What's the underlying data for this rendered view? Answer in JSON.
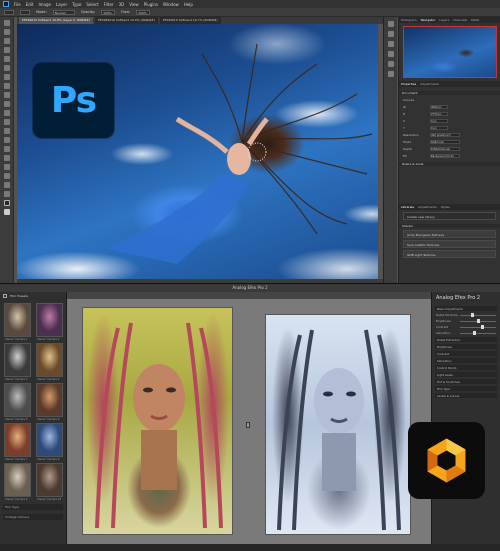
{
  "photoshop": {
    "menu": [
      "File",
      "Edit",
      "Image",
      "Layer",
      "Type",
      "Select",
      "Filter",
      "3D",
      "View",
      "Plugins",
      "Window",
      "Help"
    ],
    "options": {
      "mode_label": "Mode:",
      "mode_value": "Normal",
      "opacity_label": "Opacity:",
      "opacity_value": "100%",
      "flow_label": "Flow:",
      "flow_value": "100%"
    },
    "tabs": [
      "PF099010 SoftLand 16.8% (Layer 0, RGB/8#)",
      "PF0989010 SoftLand 16.9% (RGB/8#)",
      "PF099010 SoftLand 16.7% (RGB/8#)"
    ],
    "logo_text": "Ps",
    "right_panel": {
      "tabs": [
        "Histogram",
        "Navigator",
        "Layers",
        "Channels",
        "Paths"
      ],
      "properties_tabs": [
        "Properties",
        "Adjustments"
      ],
      "doc_label": "Document",
      "rows": [
        {
          "label": "Canvas",
          "value": ""
        },
        {
          "label": "W",
          "value": "4096 px"
        },
        {
          "label": "H",
          "value": "2730 px"
        },
        {
          "label": "X",
          "value": "0 px"
        },
        {
          "label": "Y",
          "value": "0 px"
        },
        {
          "label": "Resolution",
          "value": "300 pixels/inch"
        },
        {
          "label": "Mode",
          "value": "RGB Color"
        },
        {
          "label": "Depth",
          "value": "8 Bits/Channel"
        },
        {
          "label": "Fill",
          "value": "Background Color"
        }
      ],
      "rulers_label": "Rulers & Grids",
      "library_tabs": [
        "Libraries",
        "Adjustments",
        "Styles"
      ],
      "library_button": "Create new library",
      "library_heading": "Shared",
      "library_items": [
        "Andy Bourgeois Textures",
        "Sara Castillo Textures",
        "GDB Light Textures"
      ]
    }
  },
  "analog": {
    "title": "Analog Efex Pro 2",
    "left_head": "Film Presets",
    "thumbs": [
      {
        "caption": "Classic Camera 1",
        "c1": "#d7c2a8",
        "c2": "#5a4a3e"
      },
      {
        "caption": "Classic Camera 2",
        "c1": "#c27aa8",
        "c2": "#4a3050"
      },
      {
        "caption": "Classic Camera 3",
        "c1": "#cfcfcf",
        "c2": "#3a3a3a"
      },
      {
        "caption": "Classic Camera 4",
        "c1": "#e0c28a",
        "c2": "#6b4a2a"
      },
      {
        "caption": "Classic Camera 5",
        "c1": "#bcbcbc",
        "c2": "#4c4c4c"
      },
      {
        "caption": "Classic Camera 6",
        "c1": "#d89a6a",
        "c2": "#5a3a2a"
      },
      {
        "caption": "Classic Camera 7",
        "c1": "#e7b07a",
        "c2": "#7a3e2a"
      },
      {
        "caption": "Classic Camera 8",
        "c1": "#9ab8e0",
        "c2": "#2e4a7a"
      },
      {
        "caption": "Classic Camera 9",
        "c1": "#d6cdbd",
        "c2": "#6a6050"
      },
      {
        "caption": "Classic Camera 10",
        "c1": "#b49a8a",
        "c2": "#4a3a30"
      }
    ],
    "left_bars": [
      "Film Type",
      "Vintage Camera"
    ],
    "right_title": "Analog Efex Pro 2",
    "right_sections": [
      "Basic Adjustments",
      "Detail Extraction",
      "Brightness",
      "Contrast",
      "Saturation",
      "Control Points",
      "Light Leaks",
      "Dirt & Scratches",
      "Film Type",
      "Levels & Curves"
    ],
    "sliders": [
      {
        "label": "Detail Extraction",
        "pct": 0.35
      },
      {
        "label": "Brightness",
        "pct": 0.5
      },
      {
        "label": "Contrast",
        "pct": 0.62
      },
      {
        "label": "Saturation",
        "pct": 0.4
      }
    ]
  }
}
